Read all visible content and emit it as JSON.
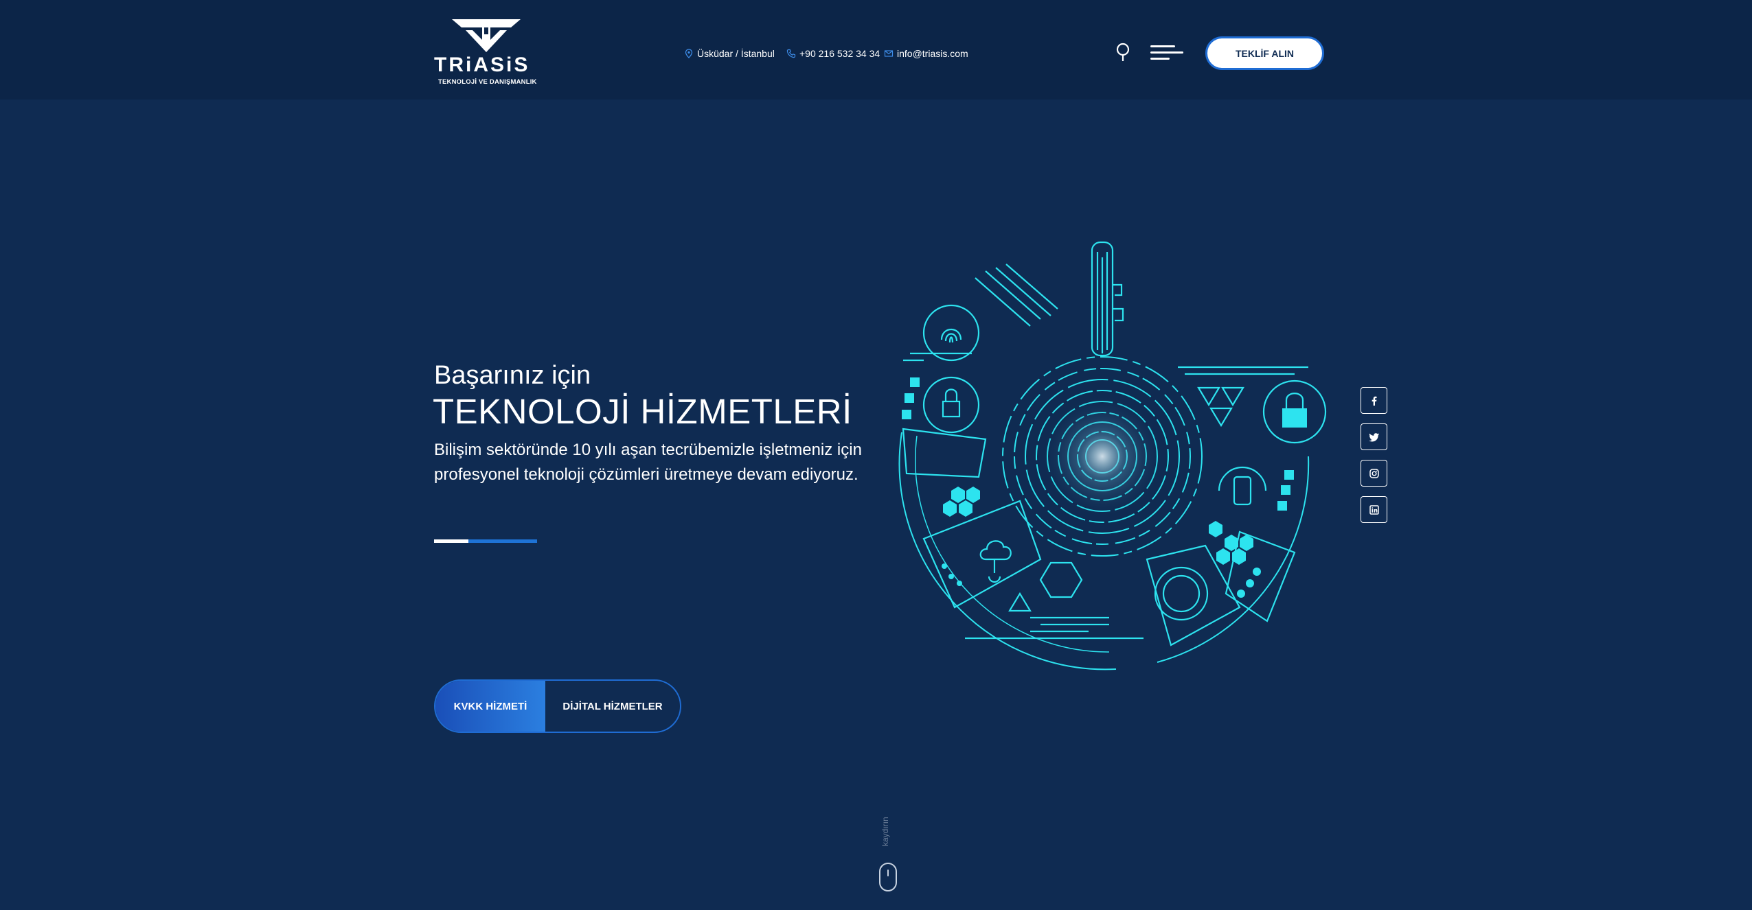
{
  "header": {
    "logo": {
      "name": "TRiASiS",
      "subtitle": "TEKNOLOJİ VE DANIŞMANLIK"
    },
    "contacts": {
      "location": "Üsküdar / İstanbul",
      "phone": "+90 216 532 34 34",
      "email": "info@triasis.com"
    },
    "quote_button": "TEKLİF ALIN"
  },
  "hero": {
    "subtitle": "Başarınız için",
    "title": "TEKNOLOJİ HİZMETLERİ",
    "description": "Bilişim sektöründe 10 yılı aşan tecrübemizle işletmeniz için profesyonel teknoloji çözümleri üretmeye devam ediyoruz.",
    "slide_progress": 0.33,
    "buttons": {
      "kvkk": "KVKK HİZMETİ",
      "dijital": "DİJİTAL HİZMETLER"
    }
  },
  "social": [
    "facebook-icon",
    "twitter-icon",
    "instagram-icon",
    "linkedin-icon"
  ],
  "scroll_label": "kaydırın",
  "colors": {
    "background": "#0f2b52",
    "header_background": "#0c2548",
    "accent": "#1f6cd3",
    "illustration": "#2de3ef"
  }
}
